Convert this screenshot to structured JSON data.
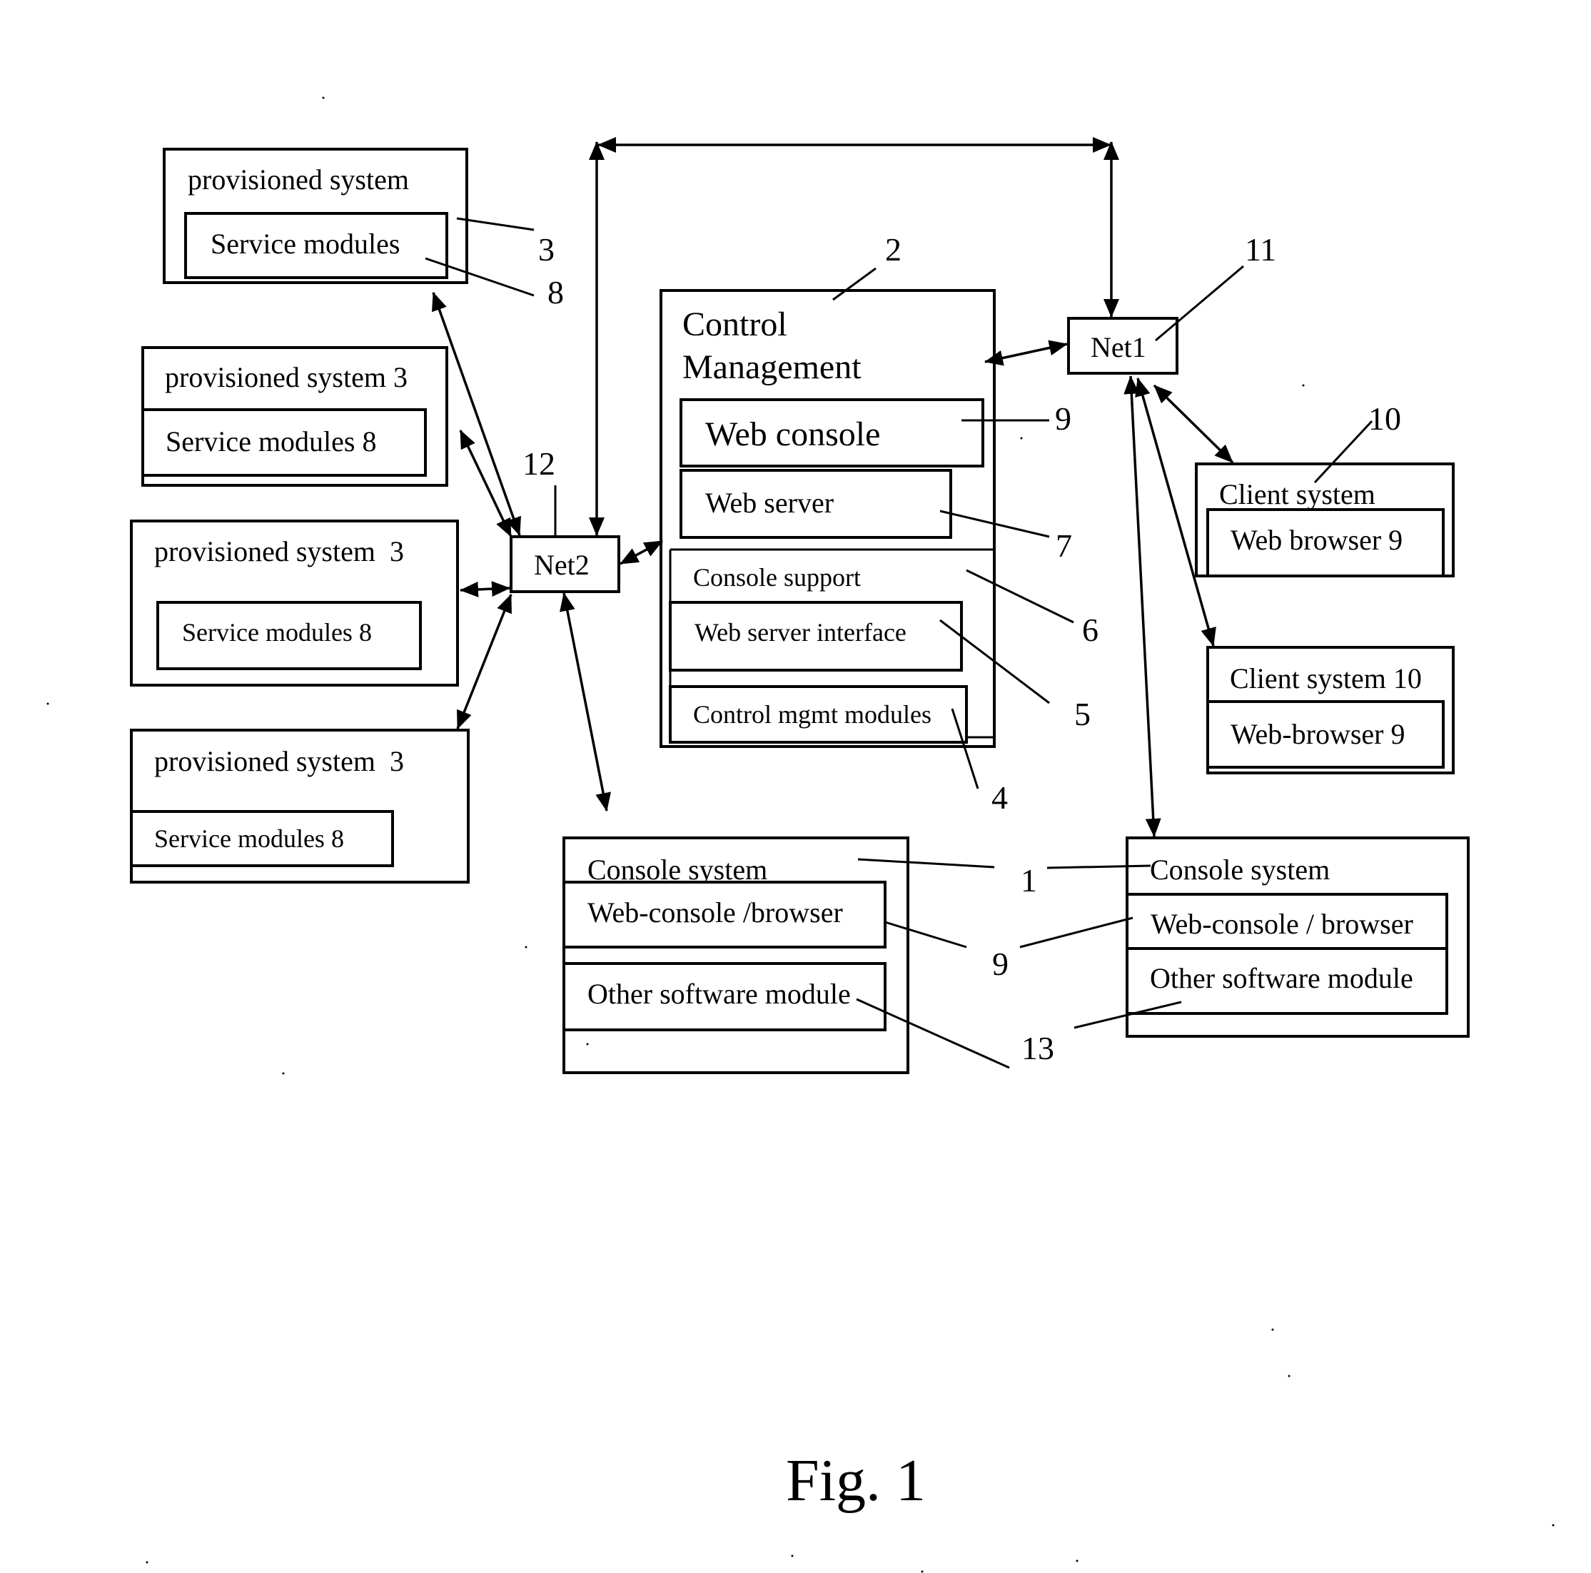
{
  "figure": {
    "caption": "Fig. 1",
    "type": "block-diagram"
  },
  "nodes": {
    "provisioned_1": {
      "title": "provisioned system",
      "module": "Service modules"
    },
    "provisioned_2": {
      "title": "provisioned system 3",
      "module": "Service modules 8"
    },
    "provisioned_3": {
      "title": "provisioned system  3",
      "module": "Service modules 8"
    },
    "provisioned_4": {
      "title": "provisioned system  3",
      "module": "Service modules 8"
    },
    "net2": {
      "label": "Net2"
    },
    "net1": {
      "label": "Net1"
    },
    "control_management": {
      "title_line1": "Control",
      "title_line2": "Management",
      "web_console": "Web console",
      "web_server": "Web server",
      "console_support": "Console support",
      "web_server_interface": "Web server interface",
      "control_mgmt_modules": "Control mgmt modules"
    },
    "client_1": {
      "title": "Client system",
      "module": "Web browser 9"
    },
    "client_2": {
      "title": "Client system 10",
      "module": "Web-browser 9"
    },
    "console_left": {
      "title": "Console system",
      "web_console": "Web-console /browser",
      "other": "Other software module"
    },
    "console_right": {
      "title": "Console system",
      "web_console": "Web-console / browser",
      "other": "Other software module"
    }
  },
  "reference_numerals": {
    "n3": "3",
    "n8": "8",
    "n2": "2",
    "n11": "11",
    "n9_web_console": "9",
    "n10": "10",
    "n12": "12",
    "n7": "7",
    "n6": "6",
    "n5": "5",
    "n4": "4",
    "n1": "1",
    "n9_consoles": "9",
    "n13": "13"
  },
  "connections": [
    {
      "from": "net2",
      "to": "net1",
      "kind": "bidirectional",
      "route": "over-top"
    },
    {
      "from": "net2",
      "to": "provisioned_1",
      "kind": "bidirectional"
    },
    {
      "from": "net2",
      "to": "provisioned_2",
      "kind": "bidirectional"
    },
    {
      "from": "net2",
      "to": "provisioned_3",
      "kind": "bidirectional"
    },
    {
      "from": "net2",
      "to": "provisioned_4",
      "kind": "bidirectional"
    },
    {
      "from": "net2",
      "to": "control_management",
      "kind": "bidirectional"
    },
    {
      "from": "net2",
      "to": "console_left",
      "kind": "bidirectional"
    },
    {
      "from": "net1",
      "to": "control_management",
      "kind": "bidirectional"
    },
    {
      "from": "net1",
      "to": "client_1",
      "kind": "bidirectional"
    },
    {
      "from": "net1",
      "to": "client_2",
      "kind": "bidirectional"
    },
    {
      "from": "net1",
      "to": "console_right",
      "kind": "bidirectional"
    }
  ]
}
